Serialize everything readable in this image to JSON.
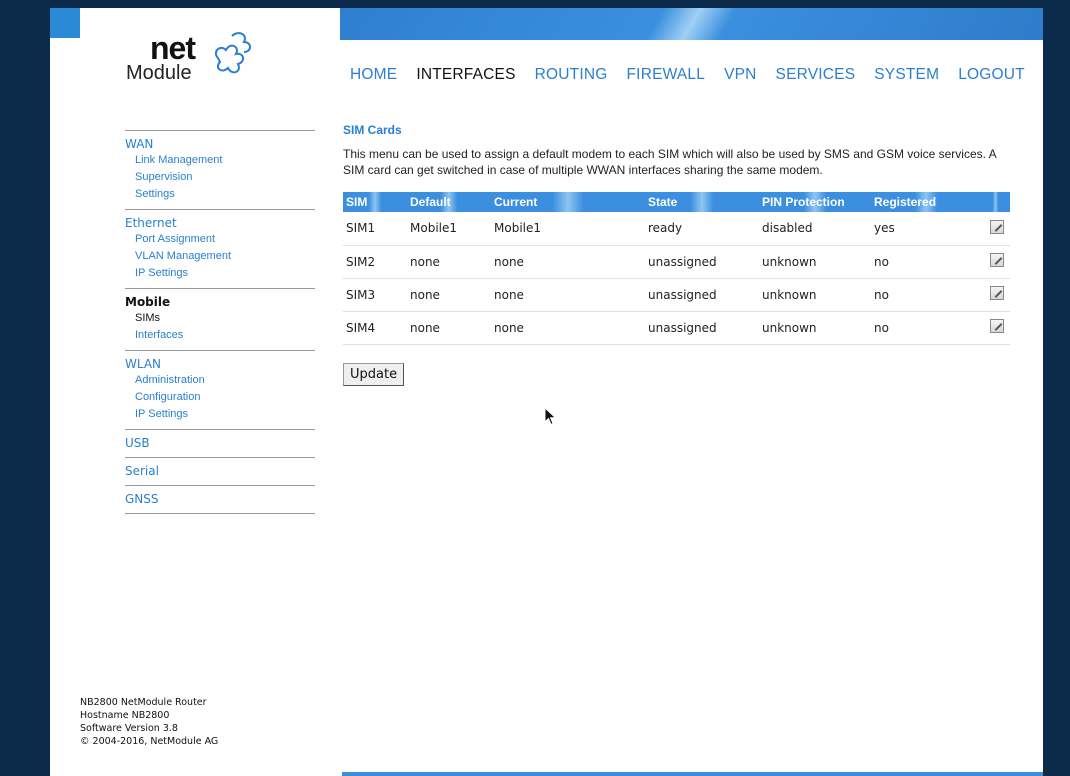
{
  "logo": {
    "net": "net",
    "module": "Module"
  },
  "topnav": {
    "items": [
      {
        "label": "HOME"
      },
      {
        "label": "INTERFACES"
      },
      {
        "label": "ROUTING"
      },
      {
        "label": "FIREWALL"
      },
      {
        "label": "VPN"
      },
      {
        "label": "SERVICES"
      },
      {
        "label": "SYSTEM"
      },
      {
        "label": "LOGOUT"
      }
    ],
    "active": "INTERFACES"
  },
  "sidebar": {
    "groups": [
      {
        "label": "WAN",
        "items": [
          "Link Management",
          "Supervision",
          "Settings"
        ]
      },
      {
        "label": "Ethernet",
        "items": [
          "Port Assignment",
          "VLAN Management",
          "IP Settings"
        ]
      },
      {
        "label": "Mobile",
        "items": [
          "SIMs",
          "Interfaces"
        ]
      },
      {
        "label": "WLAN",
        "items": [
          "Administration",
          "Configuration",
          "IP Settings"
        ]
      },
      {
        "label": "USB",
        "items": []
      },
      {
        "label": "Serial",
        "items": []
      },
      {
        "label": "GNSS",
        "items": []
      }
    ],
    "active_group": "Mobile",
    "active_item": "SIMs"
  },
  "main": {
    "title": "SIM Cards",
    "description": "This menu can be used to assign a default modem to each SIM which will also be used by SMS and GSM voice services. A SIM card can get switched in case of multiple WWAN interfaces sharing the same modem.",
    "columns": [
      "SIM",
      "Default",
      "Current",
      "State",
      "PIN Protection",
      "Registered"
    ],
    "rows": [
      [
        "SIM1",
        "Mobile1",
        "Mobile1",
        "ready",
        "disabled",
        "yes"
      ],
      [
        "SIM2",
        "none",
        "none",
        "unassigned",
        "unknown",
        "no"
      ],
      [
        "SIM3",
        "none",
        "none",
        "unassigned",
        "unknown",
        "no"
      ],
      [
        "SIM4",
        "none",
        "none",
        "unassigned",
        "unknown",
        "no"
      ]
    ],
    "update_label": "Update"
  },
  "footer": {
    "lines": [
      "NB2800 NetModule Router",
      "Hostname NB2800",
      "Software Version 3.8",
      "© 2004-2016, NetModule AG"
    ]
  },
  "colors": {
    "accent": "#2a7fd0",
    "header": "#3b8fde",
    "background": "#0c2a4a"
  }
}
